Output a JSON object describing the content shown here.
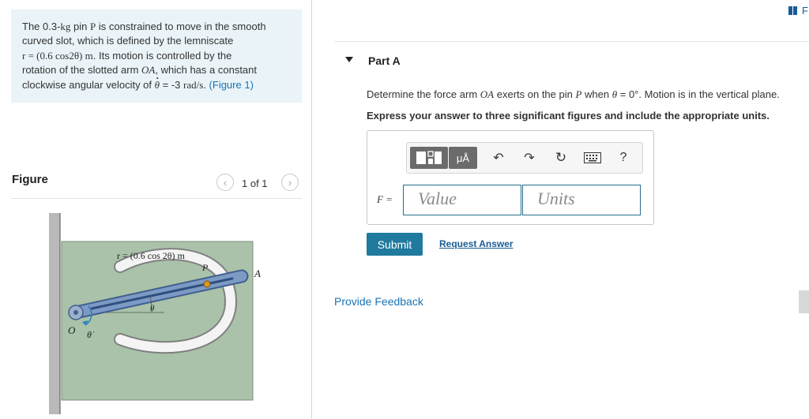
{
  "problem": {
    "line1_pre": "The 0.3-",
    "kg": "kg",
    "line1_mid": " pin ",
    "P": "P",
    "line1_post": " is constrained to move in the smooth",
    "line2": "curved slot, which is defined by the lemniscate",
    "eq": "r = (0.6 cos2θ) m",
    "line3_post": ". Its motion is controlled by the",
    "line4_pre": "rotation of the slotted arm ",
    "OA": "OA",
    "line4_post": ", which has a constant",
    "line5_pre": "clockwise angular velocity of ",
    "theta": "θ",
    "line5_eq": " = -3 ",
    "rad_s": "rad/s",
    "line5_dot": ". ",
    "figure_link": "(Figure 1)"
  },
  "figure": {
    "label": "Figure",
    "pager": "1 of 1",
    "prev_icon": "chevron-left-icon",
    "next_icon": "chevron-right-icon",
    "eq_label": "r = (0.6 cos 2θ) m",
    "label_P": "P",
    "label_A": "A",
    "label_O": "O",
    "label_theta": "θ",
    "label_thetadot": "θ̇"
  },
  "header": {
    "corner_text": "F"
  },
  "part": {
    "title": "Part A",
    "q_pre": "Determine the force arm ",
    "q_OA": "OA",
    "q_mid": " exerts on the pin ",
    "q_P": "P",
    "q_when": " when ",
    "q_theta": "θ",
    "q_val": " = 0°",
    "q_post": ". Motion is in the vertical plane.",
    "instruction": "Express your answer to three significant figures and include the appropriate units."
  },
  "answer": {
    "f_label": "F =",
    "value_placeholder": "Value",
    "units_placeholder": "Units",
    "toolbar": {
      "units_label": "μÅ",
      "undo_icon": "undo-icon",
      "redo_icon": "redo-icon",
      "reset_icon": "reset-icon",
      "keyboard_icon": "keyboard-icon",
      "help": "?"
    }
  },
  "actions": {
    "submit": "Submit",
    "request_answer": "Request Answer",
    "provide_feedback": "Provide Feedback"
  },
  "colors": {
    "accent": "#1f7a9e",
    "link": "#1a73b5",
    "problem_bg": "#eaf4f8"
  }
}
